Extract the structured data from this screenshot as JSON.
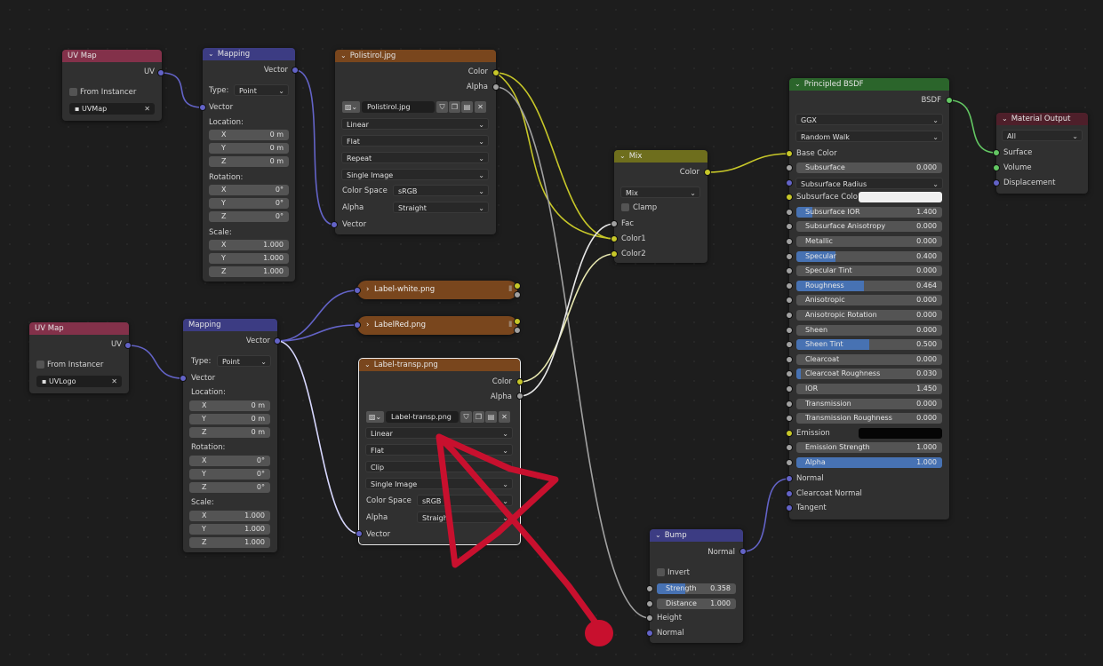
{
  "uvmap1": {
    "title": "UV Map",
    "out": "UV",
    "from_instancer": "From Instancer",
    "map": "UVMap"
  },
  "uvmap2": {
    "title": "UV Map",
    "out": "UV",
    "from_instancer": "From Instancer",
    "map": "UVLogo"
  },
  "mapping1": {
    "title": "Mapping",
    "out": "Vector",
    "type_label": "Type:",
    "type_value": "Point",
    "vector": "Vector",
    "location": "Location:",
    "loc": [
      {
        "a": "X",
        "v": "0 m"
      },
      {
        "a": "Y",
        "v": "0 m"
      },
      {
        "a": "Z",
        "v": "0 m"
      }
    ],
    "rotation": "Rotation:",
    "rot": [
      {
        "a": "X",
        "v": "0°"
      },
      {
        "a": "Y",
        "v": "0°"
      },
      {
        "a": "Z",
        "v": "0°"
      }
    ],
    "scale": "Scale:",
    "sca": [
      {
        "a": "X",
        "v": "1.000"
      },
      {
        "a": "Y",
        "v": "1.000"
      },
      {
        "a": "Z",
        "v": "1.000"
      }
    ]
  },
  "mapping2": {
    "title": "Mapping",
    "out": "Vector",
    "type_label": "Type:",
    "type_value": "Point",
    "vector": "Vector",
    "location": "Location:",
    "loc": [
      {
        "a": "X",
        "v": "0 m"
      },
      {
        "a": "Y",
        "v": "0 m"
      },
      {
        "a": "Z",
        "v": "0 m"
      }
    ],
    "rotation": "Rotation:",
    "rot": [
      {
        "a": "X",
        "v": "0°"
      },
      {
        "a": "Y",
        "v": "0°"
      },
      {
        "a": "Z",
        "v": "0°"
      }
    ],
    "scale": "Scale:",
    "sca": [
      {
        "a": "X",
        "v": "1.000"
      },
      {
        "a": "Y",
        "v": "1.000"
      },
      {
        "a": "Z",
        "v": "1.000"
      }
    ]
  },
  "tex1": {
    "title": "Polistirol.jpg",
    "out_color": "Color",
    "out_alpha": "Alpha",
    "image": "Polistirol.jpg",
    "interp": "Linear",
    "proj": "Flat",
    "ext": "Repeat",
    "source": "Single Image",
    "cs_label": "Color Space",
    "cs_value": "sRGB",
    "alpha_label": "Alpha",
    "alpha_value": "Straight",
    "vector": "Vector"
  },
  "tex_white": {
    "title": "Label-white.png"
  },
  "tex_red": {
    "title": "LabelRed.png"
  },
  "tex3": {
    "title": "Label-transp.png",
    "out_color": "Color",
    "out_alpha": "Alpha",
    "image": "Label-transp.png",
    "interp": "Linear",
    "proj": "Flat",
    "ext": "Clip",
    "source": "Single Image",
    "cs_label": "Color Space",
    "cs_value": "sRGB",
    "alpha_label": "Alpha",
    "alpha_value": "Straight",
    "vector": "Vector"
  },
  "mix": {
    "title": "Mix",
    "out": "Color",
    "mode": "Mix",
    "clamp": "Clamp",
    "fac": "Fac",
    "c1": "Color1",
    "c2": "Color2"
  },
  "bump": {
    "title": "Bump",
    "out": "Normal",
    "invert": "Invert",
    "strength_label": "Strength",
    "strength": "0.358",
    "strength_frac": 0.358,
    "distance_label": "Distance",
    "distance": "1.000",
    "height": "Height",
    "normal": "Normal"
  },
  "bsdf": {
    "title": "Principled BSDF",
    "out": "BSDF",
    "dist": "GGX",
    "sss_method": "Random Walk",
    "base_color": "Base Color",
    "rows": [
      {
        "label": "Subsurface",
        "value": "0.000",
        "frac": 0
      },
      {
        "label": "Subsurface Radius",
        "value": "",
        "frac": 0,
        "drop": true
      },
      {
        "label": "Subsurface Colo",
        "value": "",
        "frac": 0,
        "swatch": "#f0f0f0"
      },
      {
        "label": "Subsurface IOR",
        "value": "1.400",
        "frac": 0.11
      },
      {
        "label": "Subsurface Anisotropy",
        "value": "0.000",
        "frac": 0
      },
      {
        "label": "Metallic",
        "value": "0.000",
        "frac": 0
      },
      {
        "label": "Specular",
        "value": "0.400",
        "frac": 0.27
      },
      {
        "label": "Specular Tint",
        "value": "0.000",
        "frac": 0
      },
      {
        "label": "Roughness",
        "value": "0.464",
        "frac": 0.464
      },
      {
        "label": "Anisotropic",
        "value": "0.000",
        "frac": 0
      },
      {
        "label": "Anisotropic Rotation",
        "value": "0.000",
        "frac": 0
      },
      {
        "label": "Sheen",
        "value": "0.000",
        "frac": 0
      },
      {
        "label": "Sheen Tint",
        "value": "0.500",
        "frac": 0.5
      },
      {
        "label": "Clearcoat",
        "value": "0.000",
        "frac": 0
      },
      {
        "label": "Clearcoat Roughness",
        "value": "0.030",
        "frac": 0.03
      },
      {
        "label": "IOR",
        "value": "1.450",
        "frac": 0
      },
      {
        "label": "Transmission",
        "value": "0.000",
        "frac": 0
      },
      {
        "label": "Transmission Roughness",
        "value": "0.000",
        "frac": 0
      },
      {
        "label": "Emission",
        "value": "",
        "frac": 0,
        "swatch": "#050505"
      },
      {
        "label": "Emission Strength",
        "value": "1.000",
        "frac": 0
      },
      {
        "label": "Alpha",
        "value": "1.000",
        "frac": 1
      }
    ],
    "normal": "Normal",
    "clearcoat_normal": "Clearcoat Normal",
    "tangent": "Tangent"
  },
  "output": {
    "title": "Material Output",
    "target": "All",
    "surface": "Surface",
    "volume": "Volume",
    "displacement": "Displacement"
  },
  "colors": {
    "annotation": "#c8102e",
    "wire_yellow": "#c7c729",
    "wire_gray": "#a1a1a1",
    "wire_purple": "#6363c7",
    "wire_green": "#63c763"
  }
}
